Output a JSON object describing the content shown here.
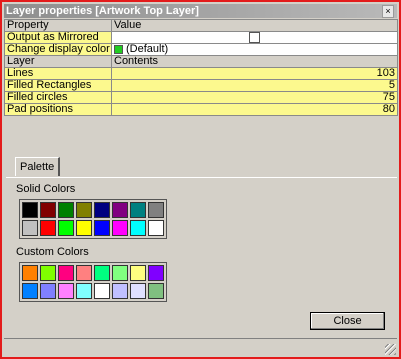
{
  "window": {
    "title": "Layer properties [Artwork Top Layer]",
    "close_glyph": "×"
  },
  "props": {
    "header_property": "Property",
    "header_value": "Value",
    "rows": [
      {
        "label": "Output as Mirrored",
        "checked": false
      },
      {
        "label": "Change display color",
        "value": "(Default)",
        "swatch": "#22cc22"
      }
    ]
  },
  "layer": {
    "header_layer": "Layer",
    "header_contents": "Contents",
    "rows": [
      {
        "label": "Lines",
        "value": "103"
      },
      {
        "label": "Filled Rectangles",
        "value": "5"
      },
      {
        "label": "Filled circles",
        "value": "75"
      },
      {
        "label": "Pad positions",
        "value": "80"
      }
    ]
  },
  "palette": {
    "tab_label": "Palette",
    "solid_label": "Solid Colors",
    "custom_label": "Custom Colors",
    "solid_colors": [
      "#000000",
      "#800000",
      "#008000",
      "#808000",
      "#000080",
      "#800080",
      "#008080",
      "#808080",
      "#c0c0c0",
      "#ff0000",
      "#00ff00",
      "#ffff00",
      "#0000ff",
      "#ff00ff",
      "#00ffff",
      "#ffffff"
    ],
    "custom_colors": [
      "#ff8000",
      "#80ff00",
      "#ff0080",
      "#ff8080",
      "#00ff80",
      "#80ff80",
      "#ffff80",
      "#8000ff",
      "#0080ff",
      "#8080ff",
      "#ff80ff",
      "#80ffff",
      "#ffffff",
      "#c0c0ff",
      "#e0e0ff",
      "#80c080"
    ]
  },
  "buttons": {
    "close_label": "Close"
  }
}
